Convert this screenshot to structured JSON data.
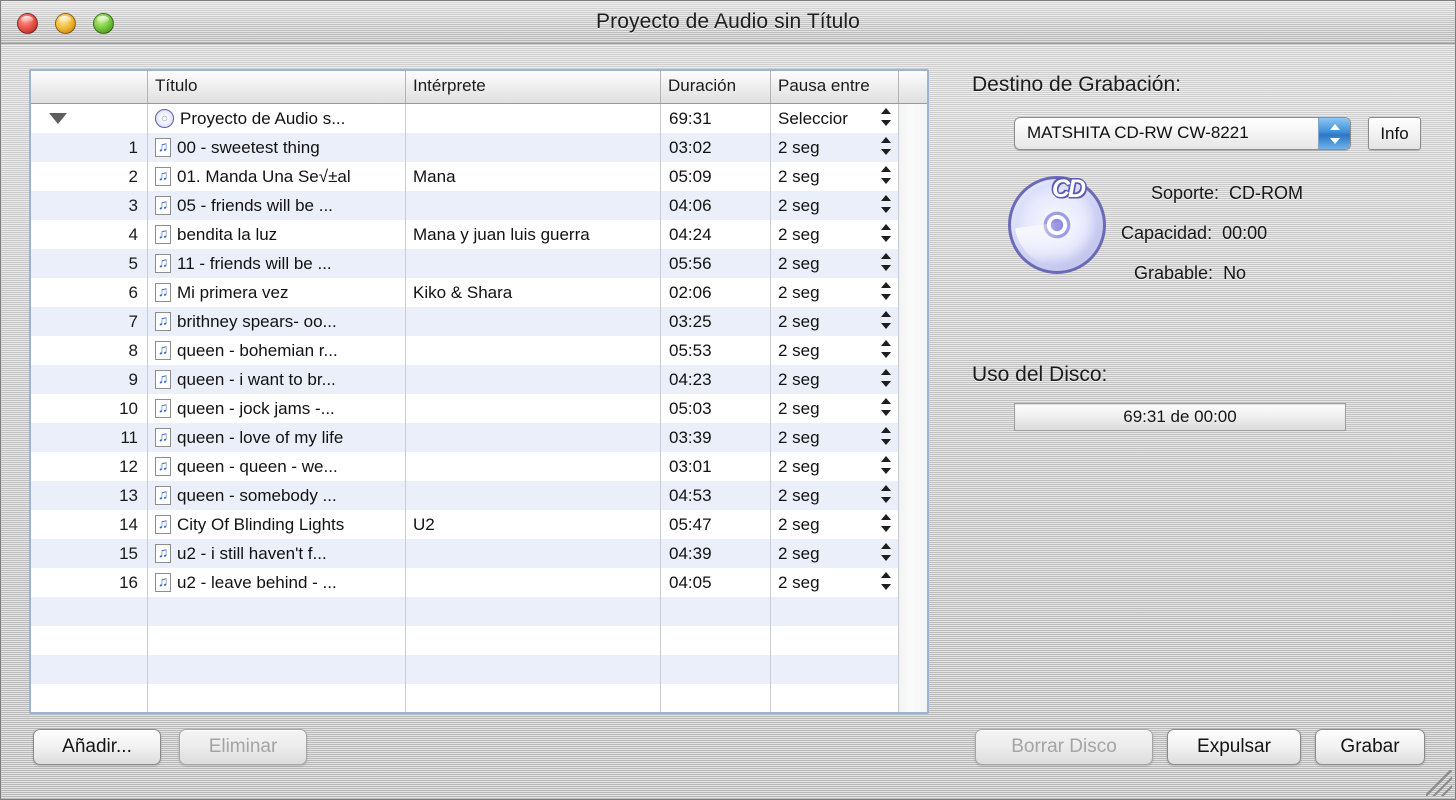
{
  "window": {
    "title": "Proyecto de Audio sin Título",
    "controls": {
      "close": "close",
      "minimize": "minimize",
      "zoom": "zoom"
    }
  },
  "table": {
    "headers": {
      "number": "",
      "title": "Título",
      "artist": "Intérprete",
      "duration": "Duración",
      "pause": "Pausa entre"
    },
    "project_row": {
      "number": "",
      "title": "Proyecto de Audio s...",
      "artist": "",
      "duration": "69:31",
      "pause": "Seleccior"
    },
    "rows": [
      {
        "number": "1",
        "title": "00 - sweetest thing",
        "artist": "",
        "duration": "03:02",
        "pause": "2 seg"
      },
      {
        "number": "2",
        "title": "01. Manda Una Se√±al",
        "artist": "Mana",
        "duration": "05:09",
        "pause": "2 seg"
      },
      {
        "number": "3",
        "title": "05 - friends will be ...",
        "artist": "",
        "duration": "04:06",
        "pause": "2 seg"
      },
      {
        "number": "4",
        "title": "bendita la luz",
        "artist": "Mana y juan luis guerra",
        "duration": "04:24",
        "pause": "2 seg"
      },
      {
        "number": "5",
        "title": "11 - friends will be ...",
        "artist": "",
        "duration": "05:56",
        "pause": "2 seg"
      },
      {
        "number": "6",
        "title": "Mi primera vez",
        "artist": "Kiko & Shara",
        "duration": "02:06",
        "pause": "2 seg"
      },
      {
        "number": "7",
        "title": "brithney spears- oo...",
        "artist": "",
        "duration": "03:25",
        "pause": "2 seg"
      },
      {
        "number": "8",
        "title": "queen - bohemian r...",
        "artist": "",
        "duration": "05:53",
        "pause": "2 seg"
      },
      {
        "number": "9",
        "title": "queen - i want to br...",
        "artist": "",
        "duration": "04:23",
        "pause": "2 seg"
      },
      {
        "number": "10",
        "title": "queen - jock jams -...",
        "artist": "",
        "duration": "05:03",
        "pause": "2 seg"
      },
      {
        "number": "11",
        "title": "queen - love of my life",
        "artist": "",
        "duration": "03:39",
        "pause": "2 seg"
      },
      {
        "number": "12",
        "title": "queen - queen - we...",
        "artist": "",
        "duration": "03:01",
        "pause": "2 seg"
      },
      {
        "number": "13",
        "title": "queen - somebody ...",
        "artist": "",
        "duration": "04:53",
        "pause": "2 seg"
      },
      {
        "number": "14",
        "title": "City Of Blinding Lights",
        "artist": "U2",
        "duration": "05:47",
        "pause": "2 seg"
      },
      {
        "number": "15",
        "title": "u2 - i still haven't f...",
        "artist": "",
        "duration": "04:39",
        "pause": "2 seg"
      },
      {
        "number": "16",
        "title": "u2 - leave behind - ...",
        "artist": "",
        "duration": "04:05",
        "pause": "2 seg"
      }
    ],
    "empty_row_count": 4
  },
  "destination": {
    "label": "Destino de Grabación:",
    "selected_device": "MATSHITA CD-RW CW-8221",
    "info_button": "Info"
  },
  "disc": {
    "icon_label": "CD",
    "specs": [
      {
        "key": "Soporte:",
        "value": "CD-ROM"
      },
      {
        "key": "Capacidad:",
        "value": "00:00"
      },
      {
        "key": "Grabable:",
        "value": "No"
      }
    ]
  },
  "usage": {
    "label": "Uso del Disco:",
    "bar_text": "69:31 de 00:00"
  },
  "buttons": {
    "add": "Añadir...",
    "remove": "Eliminar",
    "erase_disc": "Borrar Disco",
    "eject": "Expulsar",
    "burn": "Grabar"
  },
  "colors": {
    "window_chrome": "#cfcfcf",
    "table_border": "#9db3cf",
    "row_stripe": "#eaeff9",
    "popup_accent": "#3f8fd8",
    "cd_purple": "#6a6ab8"
  }
}
